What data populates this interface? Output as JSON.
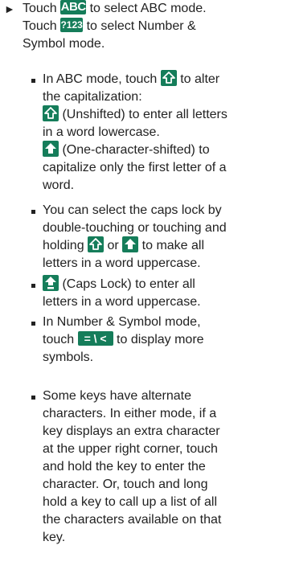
{
  "intro": {
    "p1": [
      "Touch",
      "to select ABC mode."
    ],
    "p2": [
      "Touch",
      "to select Number &"
    ],
    "p3": "Symbol mode."
  },
  "keys": {
    "abc": "ABC",
    "num": "?123",
    "sym": "= \\ <"
  },
  "bullets": {
    "b1": {
      "l1": [
        "In ABC mode, touch",
        "to alter"
      ],
      "l2": "the capitalization:",
      "l3": "(Unshifted) to enter all letters",
      "l4": "in a word lowercase.",
      "l5": "(One-character-shifted) to",
      "l6": "capitalize only the first letter of a",
      "l7": "word."
    },
    "b2": {
      "l1": "You can select the caps lock by",
      "l2": "double-touching or touching and",
      "l3": [
        "holding",
        "or",
        "to make all"
      ],
      "l4": "letters in a word uppercase."
    },
    "b3": {
      "l1": "(Caps Lock) to enter all",
      "l2": "letters in a word uppercase."
    },
    "b4": {
      "l1": "In Number & Symbol mode,",
      "l2": [
        "touch",
        "to display more"
      ],
      "l3": "symbols."
    },
    "b5": {
      "lines": [
        "Some keys have alternate",
        "characters. In either mode, if a",
        "key displays an extra character",
        "at the upper right corner, touch",
        "and hold the key to enter the",
        "character. Or, touch and long",
        "hold a key to call up a list of all",
        "the characters available on that",
        "key."
      ]
    }
  },
  "icons": {
    "arrow": "right-pointer",
    "shift_unshifted": "shift-outline",
    "shift_shifted": "shift-filled",
    "shift_capslock": "shift-capslock"
  },
  "colors": {
    "key_bg": "#157d5a",
    "key_fg": "#ffffff",
    "text": "#222222"
  }
}
